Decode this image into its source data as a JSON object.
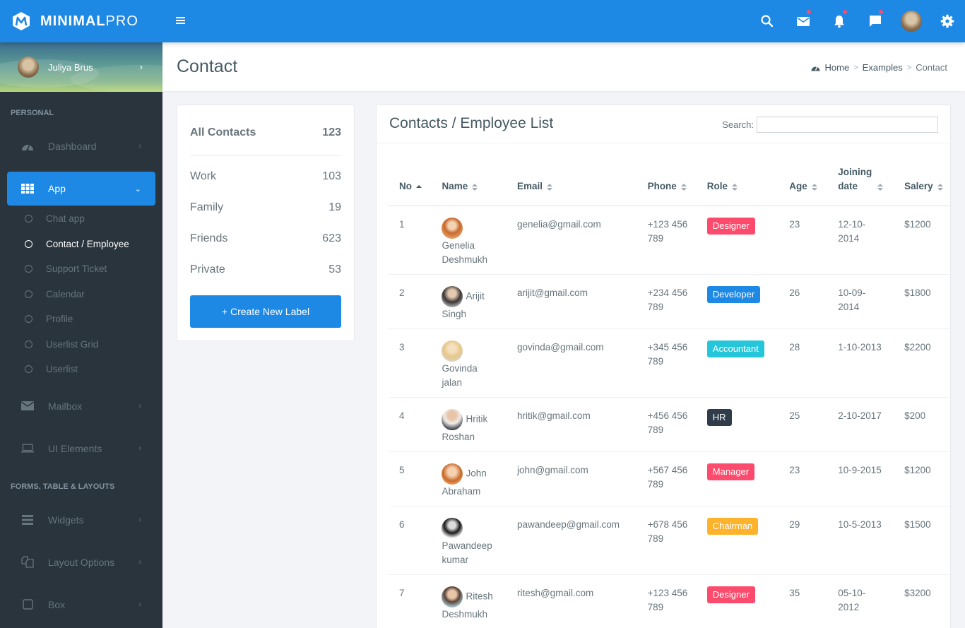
{
  "brand": {
    "bold": "MINIMAL",
    "light": "PRO",
    "accent": "#1e88e5"
  },
  "header": {
    "icons": [
      {
        "name": "search-icon",
        "notify": false
      },
      {
        "name": "mail-icon",
        "notify": true
      },
      {
        "name": "bell-icon",
        "notify": true
      },
      {
        "name": "chat-icon",
        "notify": true
      },
      {
        "name": "user-avatar",
        "notify": false
      },
      {
        "name": "gear-icon",
        "notify": false
      }
    ]
  },
  "sidebar": {
    "user": {
      "name": "Juliya Brus"
    },
    "sections": [
      {
        "title": "PERSONAL"
      },
      {
        "title": "FORMS, TABLE & LAYOUTS"
      }
    ],
    "items": {
      "dashboard": "Dashboard",
      "app": "App",
      "mailbox": "Mailbox",
      "ui_elements": "UI Elements",
      "widgets": "Widgets",
      "layout_options": "Layout Options",
      "box": "Box"
    },
    "app_submenu": [
      "Chat app",
      "Contact / Employee",
      "Support Ticket",
      "Calendar",
      "Profile",
      "Userlist Grid",
      "Userlist"
    ]
  },
  "page": {
    "title": "Contact",
    "breadcrumb": [
      "Home",
      "Examples",
      "Contact"
    ]
  },
  "labels": {
    "all": {
      "label": "All Contacts",
      "count": "123"
    },
    "items": [
      {
        "label": "Work",
        "count": "103"
      },
      {
        "label": "Family",
        "count": "19"
      },
      {
        "label": "Friends",
        "count": "623"
      },
      {
        "label": "Private",
        "count": "53"
      }
    ],
    "create_button": "+ Create New Label"
  },
  "contacts": {
    "title": "Contacts / Employee List",
    "search_label": "Search:",
    "search_value": "",
    "columns": [
      "No",
      "Name",
      "Email",
      "Phone",
      "Role",
      "Age",
      "Joining date",
      "Salery"
    ],
    "rows": [
      {
        "no": "1",
        "first": "Genelia",
        "last": "Deshmukh",
        "email": "genelia@gmail.com",
        "phone": "+123 456 789",
        "role": "Designer",
        "role_color": "#fc4b6c",
        "age": "23",
        "joining": "12-10-2014",
        "salary": "$1200"
      },
      {
        "no": "2",
        "first": "Arijit",
        "last": "Singh",
        "email": "arijit@gmail.com",
        "phone": "+234 456 789",
        "role": "Developer",
        "role_color": "#1e88e5",
        "age": "26",
        "joining": "10-09-2014",
        "salary": "$1800"
      },
      {
        "no": "3",
        "first": "Govinda",
        "last": "jalan",
        "email": "govinda@gmail.com",
        "phone": "+345 456 789",
        "role": "Accountant",
        "role_color": "#26c6da",
        "age": "28",
        "joining": "1-10-2013",
        "salary": "$2200"
      },
      {
        "no": "4",
        "first": "Hritik",
        "last": "Roshan",
        "email": "hritik@gmail.com",
        "phone": "+456 456 789",
        "role": "HR",
        "role_color": "#2f3d4a",
        "age": "25",
        "joining": "2-10-2017",
        "salary": "$200"
      },
      {
        "no": "5",
        "first": "John",
        "last": "Abraham",
        "email": "john@gmail.com",
        "phone": "+567 456 789",
        "role": "Manager",
        "role_color": "#fc4b6c",
        "age": "23",
        "joining": "10-9-2015",
        "salary": "$1200"
      },
      {
        "no": "6",
        "first": "Pawandeep",
        "last": "kumar",
        "email": "pawandeep@gmail.com",
        "phone": "+678 456 789",
        "role": "Chairman",
        "role_color": "#ffb22b",
        "age": "29",
        "joining": "10-5-2013",
        "salary": "$1500"
      },
      {
        "no": "7",
        "first": "Ritesh",
        "last": "Deshmukh",
        "email": "ritesh@gmail.com",
        "phone": "+123 456 789",
        "role": "Designer",
        "role_color": "#fc4b6c",
        "age": "35",
        "joining": "05-10-2012",
        "salary": "$3200"
      }
    ]
  }
}
